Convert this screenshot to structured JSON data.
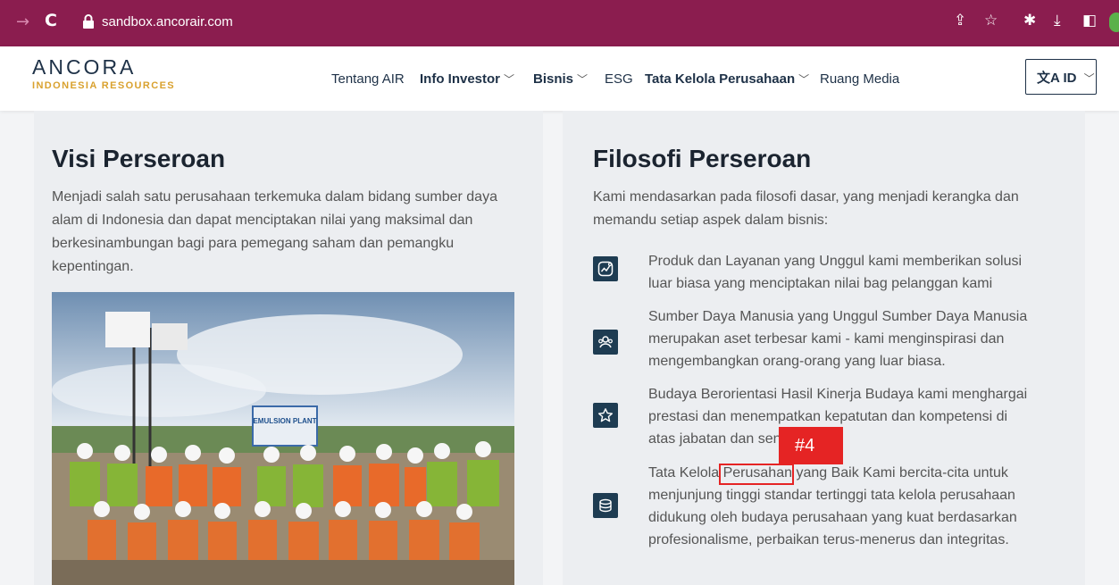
{
  "browser": {
    "url": "sandbox.ancorair.com"
  },
  "header": {
    "logo_main": "ANCORA",
    "logo_sub": "INDONESIA RESOURCES",
    "nav": [
      {
        "label": "Tentang AIR"
      },
      {
        "label": "Info Investor"
      },
      {
        "label": "Bisnis"
      },
      {
        "label": "ESG"
      },
      {
        "label": "Tata Kelola Perusahaan"
      },
      {
        "label": "Ruang Media"
      }
    ],
    "language": "ID"
  },
  "visi": {
    "title": "Visi Perseroan",
    "lines": [
      "Menjadi salah satu perusahaan terkemuka dalam bidang sumber daya",
      "alam di Indonesia dan dapat menciptakan nilai yang maksimal dan",
      "berkesinambungan bagi para pemegang saham dan pemangku",
      "kepentingan."
    ],
    "photo_sign": "EMULSION PLANT"
  },
  "filosofi": {
    "title": "Filosofi Perseroan",
    "intro_lines": [
      "Kami mendasarkan pada filosofi dasar, yang menjadi kerangka dan",
      "memandu setiap aspek dalam bisnis:"
    ],
    "items": [
      {
        "icon": "chart-icon",
        "lines": [
          "Produk dan Layanan yang Unggul kami memberikan solusi",
          "luar biasa yang menciptakan nilai bag pelanggan kami"
        ]
      },
      {
        "icon": "people-icon",
        "lines": [
          "Sumber Daya Manusia yang Unggul Sumber Daya Manusia",
          "merupakan aset terbesar kami - kami menginspirasi dan",
          "mengembangkan orang-orang yang luar biasa."
        ]
      },
      {
        "icon": "star-icon",
        "lines": [
          "Budaya Berorientasi Hasil Kinerja Budaya kami menghargai",
          "prestasi dan menempatkan kepatutan dan kompetensi di",
          "atas jabatan dan senioritas."
        ]
      },
      {
        "icon": "coins-icon",
        "lines": [
          "Tata Kelola Perusahan yang Baik Kami bercita-cita untuk",
          "menjunjung tinggi standar tertinggi tata kelola perusahaan",
          "didukung oleh budaya perusahaan yang kuat berdasarkan",
          "profesionalisme, perbaikan terus-menerus dan integritas."
        ]
      }
    ]
  },
  "annotation": {
    "tag": "#4"
  },
  "colors": {
    "browser_bar": "#8b1d4f",
    "brand_navy": "#1e3147",
    "brand_gold": "#d9a12e",
    "highlight": "#e52424"
  }
}
